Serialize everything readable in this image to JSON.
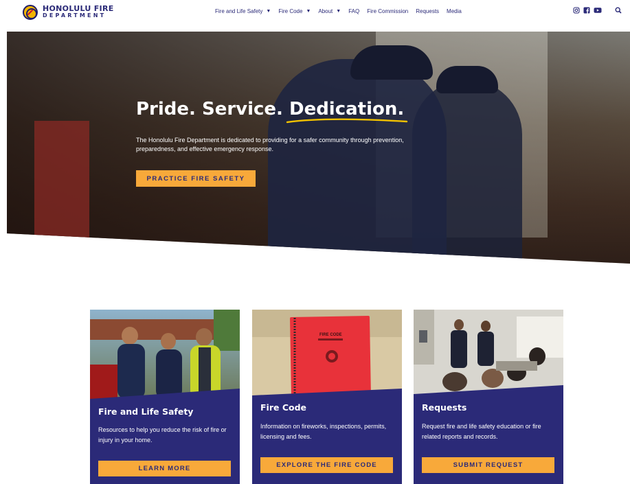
{
  "logo": {
    "line1": "HONOLULU FIRE",
    "line2": "DEPARTMENT"
  },
  "nav": [
    {
      "label": "Fire and Life Safety",
      "has_dropdown": true
    },
    {
      "label": "Fire Code",
      "has_dropdown": true
    },
    {
      "label": "About",
      "has_dropdown": true
    },
    {
      "label": "FAQ",
      "has_dropdown": false
    },
    {
      "label": "Fire Commission",
      "has_dropdown": false
    },
    {
      "label": "Requests",
      "has_dropdown": false
    },
    {
      "label": "Media",
      "has_dropdown": false
    }
  ],
  "social": {
    "icons": [
      "instagram-icon",
      "facebook-icon",
      "youtube-icon"
    ]
  },
  "hero": {
    "title_part1": "Pride. Service. ",
    "title_part2": "Dedication.",
    "subtitle": "The Honolulu Fire Department is dedicated to providing for a safer community through prevention, preparedness, and effective emergency response.",
    "button": "PRACTICE FIRE SAFETY"
  },
  "cards": [
    {
      "title": "Fire and Life Safety",
      "text": "Resources to help you reduce the risk of fire or injury in your home.",
      "button": "LEARN MORE"
    },
    {
      "title": "Fire Code",
      "text": "Information on fireworks, inspections, permits, licensing and fees.",
      "button": "EXPLORE THE FIRE CODE",
      "image_text": "FIRE CODE"
    },
    {
      "title": "Requests",
      "text": "Request fire and life safety education or fire related reports and records.",
      "button": "SUBMIT REQUEST"
    }
  ],
  "colors": {
    "navy": "#2b2a78",
    "accent": "#f8a93a",
    "underline": "#f2c200"
  }
}
